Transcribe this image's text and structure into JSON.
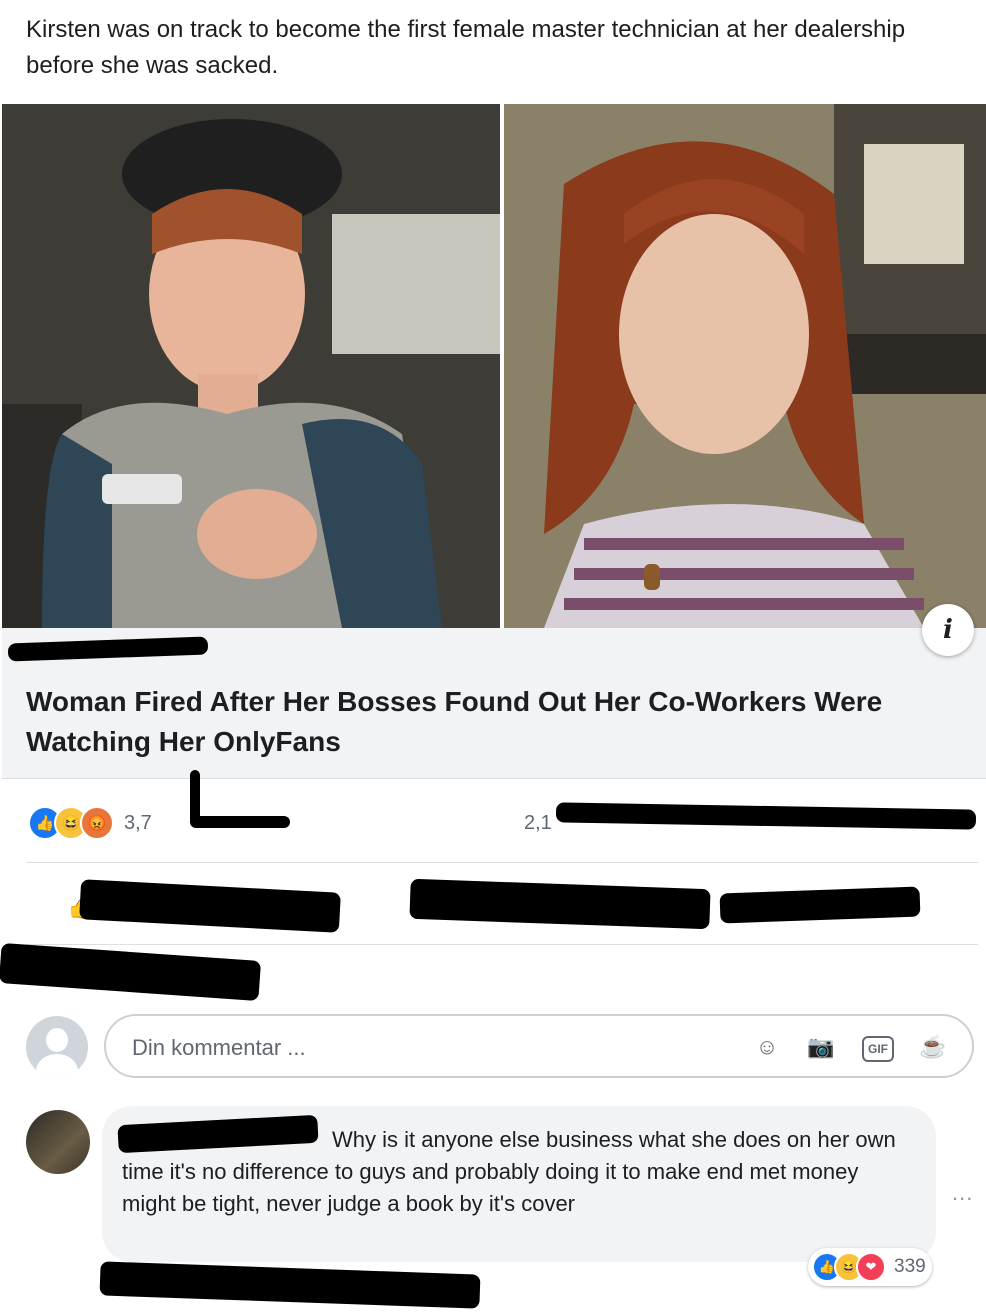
{
  "post": {
    "text": "Kirsten was on track to become the first female master technician at her dealership before she was sacked."
  },
  "link": {
    "domain": "",
    "headline": "Woman Fired After Her Bosses Found Out Her Co-Workers Were Watching Her OnlyFans",
    "info_icon": "info-icon",
    "info_label": "i"
  },
  "stats": {
    "reactions_count": "3,7",
    "comments_count": "2,1",
    "reaction_icons": [
      "like-icon",
      "haha-icon",
      "angry-icon"
    ]
  },
  "comment_input": {
    "placeholder": "Din kommentar ...",
    "icons": [
      "emoji-icon",
      "camera-icon",
      "gif-icon",
      "sticker-icon"
    ],
    "gif_label": "GIF"
  },
  "comment": {
    "author": "",
    "text": "Why is it anyone else business what she does on her own time it's no difference to guys and probably doing it to make end met money might be tight, never judge a book by it's cover",
    "reaction_count": "339",
    "more_label": "..."
  },
  "colors": {
    "like": "#1877f2",
    "haha": "#f7c33c",
    "angry": "#e8753a",
    "love": "#f33e58",
    "link_bg": "#f2f3f5"
  }
}
